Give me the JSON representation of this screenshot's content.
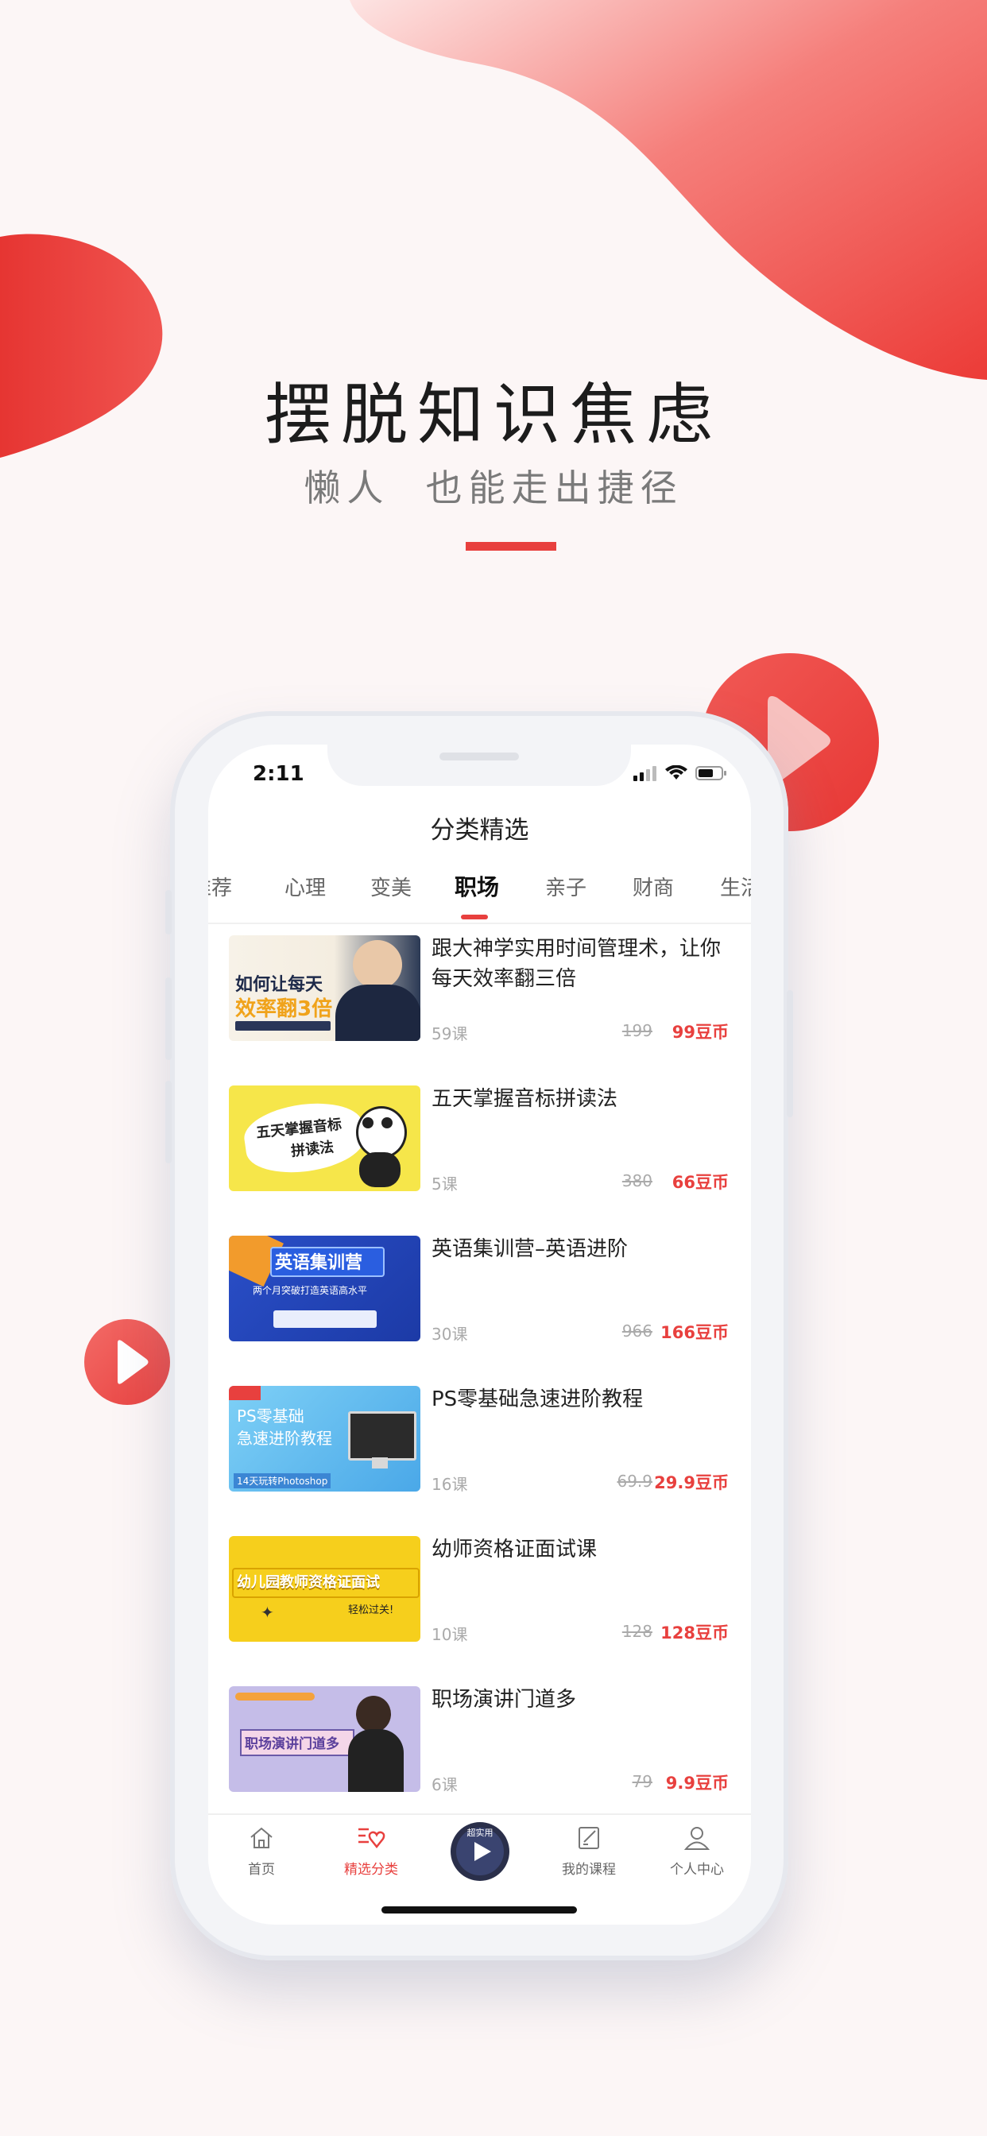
{
  "promo": {
    "title": "摆脱知识焦虑",
    "subtitle": "懒人  也能走出捷径"
  },
  "colors": {
    "accent": "#e8403e",
    "background": "#fcf6f6"
  },
  "status_bar": {
    "time": "2:11",
    "icons": [
      "signal-icon",
      "wifi-icon",
      "battery-icon"
    ]
  },
  "page": {
    "title": "分类精选"
  },
  "tabs": [
    {
      "label": "推荐"
    },
    {
      "label": "心理"
    },
    {
      "label": "变美"
    },
    {
      "label": "职场",
      "active": true
    },
    {
      "label": "亲子"
    },
    {
      "label": "财商"
    },
    {
      "label": "生活"
    }
  ],
  "courses": [
    {
      "title": "跟大神学实用时间管理术，让你每天效率翻三倍",
      "lessons": "59课",
      "price_old": "199",
      "price_new": "99豆币",
      "thumb_text": [
        "如何让每天",
        "效率翻3倍"
      ]
    },
    {
      "title": "五天掌握音标拼读法",
      "lessons": "5课",
      "price_old": "380",
      "price_new": "66豆币",
      "thumb_text": [
        "五天掌握音标",
        "拼读法"
      ]
    },
    {
      "title": "英语集训营–英语进阶",
      "lessons": "30课",
      "price_old": "966",
      "price_new": "166豆币",
      "thumb_text": [
        "英语集训营",
        "两个月突破打造英语高水平"
      ]
    },
    {
      "title": "PS零基础急速进阶教程",
      "lessons": "16课",
      "price_old": "69.9",
      "price_new": "29.9豆币",
      "thumb_text": [
        "PS零基础",
        "急速进阶教程",
        "14天玩转Photoshop"
      ]
    },
    {
      "title": "幼师资格证面试课",
      "lessons": "10课",
      "price_old": "128",
      "price_new": "128豆币",
      "thumb_text": [
        "幼儿园教师资格证面试",
        "轻松过关!"
      ]
    },
    {
      "title": "职场演讲门道多",
      "lessons": "6课",
      "price_old": "79",
      "price_new": "9.9豆币",
      "thumb_text": [
        "职场演讲门道多"
      ]
    }
  ],
  "bottom_nav": [
    {
      "label": "首页",
      "icon": "home-icon"
    },
    {
      "label": "精选分类",
      "icon": "category-icon",
      "active": true
    },
    {
      "label": "",
      "icon": "player-disc-icon",
      "disc_text": "超实用"
    },
    {
      "label": "我的课程",
      "icon": "my-courses-icon"
    },
    {
      "label": "个人中心",
      "icon": "profile-icon"
    }
  ]
}
